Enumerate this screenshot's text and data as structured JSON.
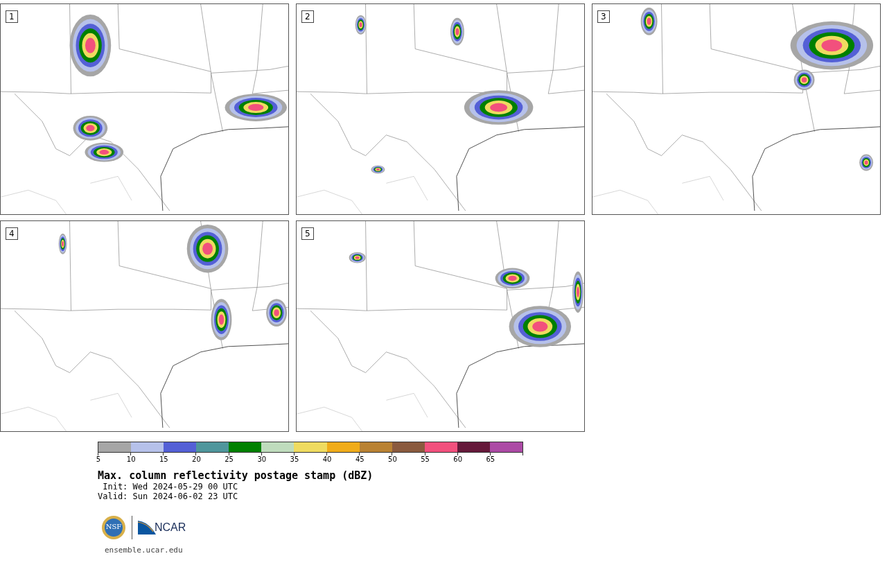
{
  "panels": [
    {
      "label": "1"
    },
    {
      "label": "2"
    },
    {
      "label": "3"
    },
    {
      "label": "4"
    },
    {
      "label": "5"
    }
  ],
  "colorbar": {
    "segments": [
      {
        "color": "#a6a6a6"
      },
      {
        "color": "#b6c1ea"
      },
      {
        "color": "#5460d6"
      },
      {
        "color": "#4f969c"
      },
      {
        "color": "#008000"
      },
      {
        "color": "#bfdcbd"
      },
      {
        "color": "#efdb60"
      },
      {
        "color": "#f0ac1a"
      },
      {
        "color": "#b98233"
      },
      {
        "color": "#8a5a3e"
      },
      {
        "color": "#f2507d"
      },
      {
        "color": "#65193a"
      },
      {
        "color": "#ac4aa5"
      }
    ],
    "ticks": [
      "5",
      "10",
      "15",
      "20",
      "25",
      "30",
      "35",
      "40",
      "45",
      "50",
      "55",
      "60",
      "65"
    ]
  },
  "title": "Max. column reflectivity postage stamp (dBZ)",
  "init": " Init: Wed 2024-05-29 00 UTC",
  "valid": "Valid: Sun 2024-06-02 23 UTC",
  "logo_text": [
    "NSF",
    "NCAR"
  ],
  "site": "ensemble.ucar.edu"
}
